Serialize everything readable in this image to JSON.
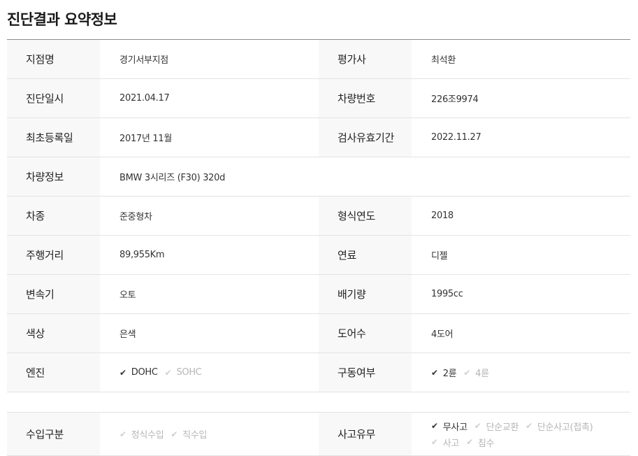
{
  "title": "진단결과 요약정보",
  "rows": [
    {
      "l1": "지점명",
      "v1": "경기서부지점",
      "l2": "평가사",
      "v2": "최석환"
    },
    {
      "l1": "진단일시",
      "v1": "2021.04.17",
      "l2": "차량번호",
      "v2": "226조9974"
    },
    {
      "l1": "최초등록일",
      "v1": "2017년 11월",
      "l2": "검사유효기간",
      "v2": "2022.11.27"
    },
    {
      "l1": "차량정보",
      "v1": "BMW 3시리즈 (F30) 320d"
    },
    {
      "l1": "차종",
      "v1": "준중형차",
      "l2": "형식연도",
      "v2": "2018"
    },
    {
      "l1": "주행거리",
      "v1": "89,955Km",
      "l2": "연료",
      "v2": "디젤"
    },
    {
      "l1": "변속기",
      "v1": "오토",
      "l2": "배기량",
      "v2": "1995cc"
    },
    {
      "l1": "색상",
      "v1": "은색",
      "l2": "도어수",
      "v2": "4도어"
    },
    {
      "l1": "엔진",
      "l2": "구동여부"
    }
  ],
  "engine": {
    "dohc": "DOHC",
    "sohc": "SOHC"
  },
  "drive": {
    "wd2": "2륜",
    "wd4": "4륜"
  },
  "import": {
    "label": "수입구분",
    "opt1": "정식수입",
    "opt2": "직수입"
  },
  "accident": {
    "label": "사고유무",
    "opt1": "무사고",
    "opt2": "단순교환",
    "opt3": "단순사고(접촉)",
    "opt4": "사고",
    "opt5": "침수"
  },
  "check_icon": "check-icon"
}
